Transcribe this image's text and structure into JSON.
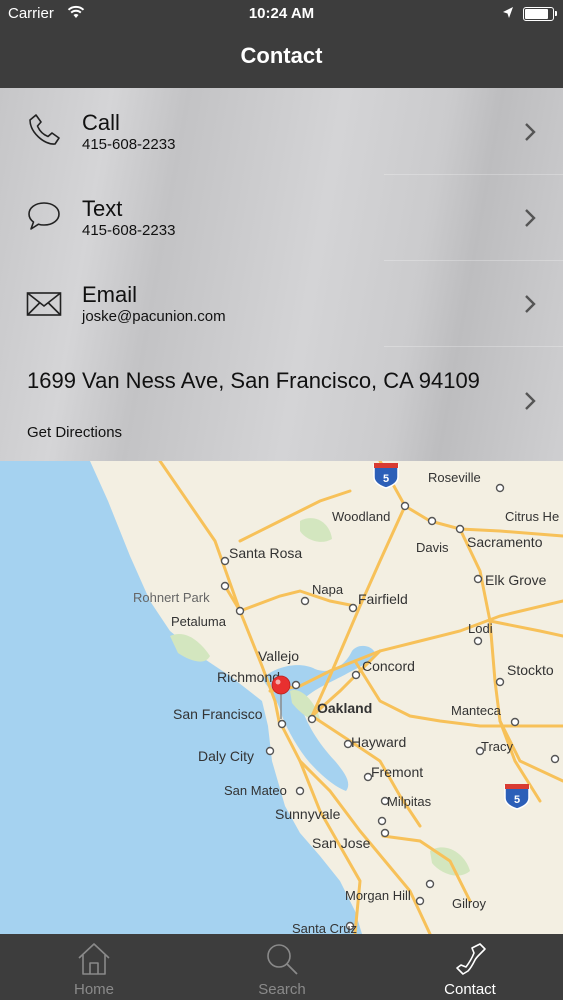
{
  "status_bar": {
    "carrier": "Carrier",
    "time": "10:24 AM",
    "battery_level": 0.9
  },
  "nav": {
    "title": "Contact"
  },
  "contact": {
    "call": {
      "title": "Call",
      "value": "415-608-2233",
      "icon": "phone-icon"
    },
    "text": {
      "title": "Text",
      "value": "415-608-2233",
      "icon": "chat-bubble-icon"
    },
    "email": {
      "title": "Email",
      "value": "joske@pacunion.com",
      "icon": "envelope-icon"
    },
    "address": {
      "line": "1699 Van Ness Ave, San Francisco, CA 94109",
      "action": "Get Directions"
    }
  },
  "map": {
    "labels": {
      "roseville": "Roseville",
      "woodland": "Woodland",
      "citrus_heights": "Citrus He",
      "davis": "Davis",
      "sacramento": "Sacramento",
      "santa_rosa": "Santa Rosa",
      "elk_grove": "Elk Grove",
      "napa": "Napa",
      "rohnert_park": "Rohnert Park",
      "fairfield": "Fairfield",
      "petaluma": "Petaluma",
      "lodi": "Lodi",
      "vallejo": "Vallejo",
      "richmond": "Richmond",
      "concord": "Concord",
      "stockton": "Stockto",
      "oakland": "Oakland",
      "san_francisco": "San Francisco",
      "manteca": "Manteca",
      "hayward": "Hayward",
      "daly_city": "Daly City",
      "tracy": "Tracy",
      "fremont": "Fremont",
      "san_mateo": "San Mateo",
      "milpitas": "Milpitas",
      "sunnyvale": "Sunnyvale",
      "san_jose": "San Jose",
      "morgan_hill": "Morgan Hill",
      "gilroy": "Gilroy",
      "santa_cruz": "Santa Cruz"
    },
    "interstate_shield": "5",
    "colors": {
      "water": "#a5d2f0",
      "land": "#f3efe2",
      "roads": "#f7c159",
      "pin": "#e8302f"
    }
  },
  "tabs": [
    {
      "label": "Home",
      "icon": "house-icon",
      "active": false
    },
    {
      "label": "Search",
      "icon": "magnifier-icon",
      "active": false
    },
    {
      "label": "Contact",
      "icon": "phone-icon",
      "active": true
    }
  ]
}
